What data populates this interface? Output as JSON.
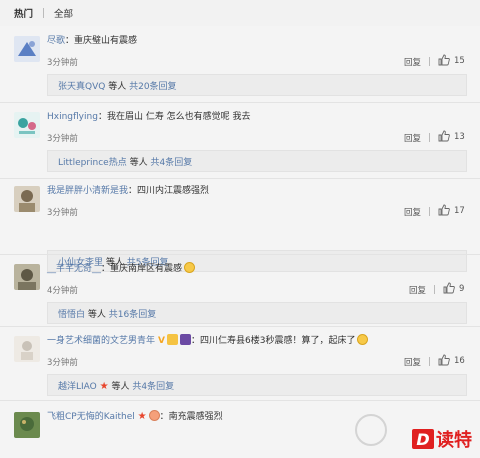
{
  "tabs": {
    "hot": "热门",
    "all": "全部"
  },
  "labels": {
    "reply": "回复",
    "people_suffix": "等人",
    "total_prefix": "共"
  },
  "comments": [
    {
      "user": "尽歌",
      "text": "重庆璧山有震感",
      "time": "3分钟前",
      "likes": "15",
      "sub_user": "张天真QVQ",
      "sub_count": "共20条回复",
      "avatar_color": "#5a7fc4"
    },
    {
      "user": "Hxingflying",
      "text": "我在眉山 仁寿 怎么也有感觉呢 我去",
      "time": "3分钟前",
      "likes": "13",
      "sub_user": "Littleprince热点",
      "sub_count": "共4条回复",
      "avatar_color": "#3aa3a0"
    },
    {
      "user": "我是胖胖小清新是我",
      "text": "四川内江震感强烈",
      "time": "3分钟前",
      "likes": "17",
      "sub_user": "小仙女李里",
      "sub_count": "共5条回复",
      "avatar_color": "#9b8b6e"
    },
    {
      "user": "__芊芊无奇__",
      "text": "重庆南岸区有震感",
      "time": "4分钟前",
      "likes": "9",
      "sub_user": "悟悟白",
      "sub_count": "共16条回复",
      "avatar_color": "#7b7560"
    },
    {
      "user": "一身艺术细菌的文艺男青年",
      "text": "四川仁寿县6楼3秒震感！算了，起床了",
      "time": "3分钟前",
      "likes": "16",
      "sub_user": "越洋LIAO",
      "sub_count": "共4条回复",
      "avatar_color": "#c9c2b8"
    },
    {
      "user": "飞粗CP无悔的Kaithel",
      "text": "南充震感强烈",
      "time": "",
      "likes": "",
      "avatar_color": "#4a6b3a"
    }
  ],
  "watermark": {
    "logo_letter": "D",
    "brand": "读特"
  }
}
